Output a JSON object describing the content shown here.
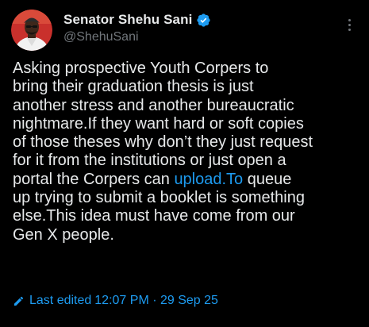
{
  "author": {
    "display_name": "Senator Shehu Sani",
    "handle": "@ShehuSani",
    "verified": true,
    "avatar_icon": "profile-photo"
  },
  "tweet": {
    "text_before_link": "Asking prospective Youth Corpers to\nbring their graduation thesis is just\nanother stress and another bureaucratic\nnightmare.If they want hard or soft copies\nof those theses why don’t they just request\nfor it from the institutions or just open a\nportal the Corpers can ",
    "link_text": "upload.To",
    "text_after_link": " queue\nup trying to submit a booklet is something\nelse.This idea must have come from our\nGen X people."
  },
  "edit_info": {
    "label": "Last edited",
    "timestamp": "12:07 PM · 29 Sep 25",
    "icon": "pencil-icon"
  },
  "colors": {
    "background": "#000000",
    "text": "#e7e9ea",
    "secondary": "#71767b",
    "accent": "#1d9bf0"
  }
}
